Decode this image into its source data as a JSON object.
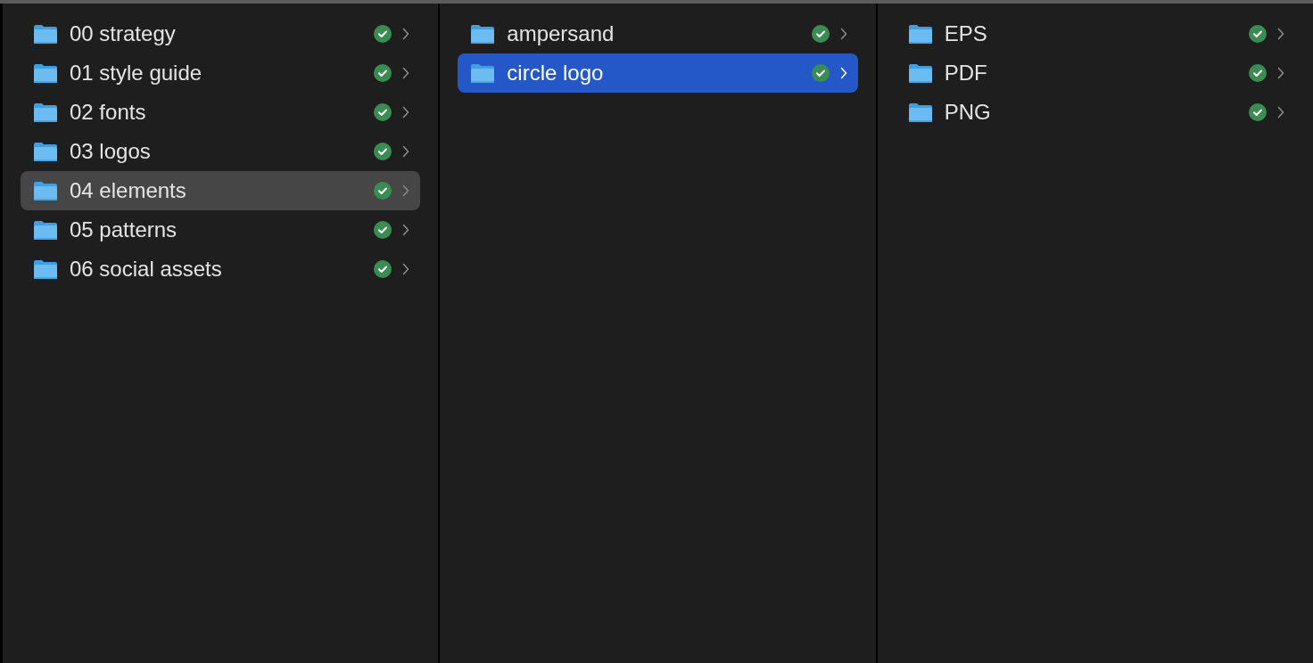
{
  "columns": [
    {
      "items": [
        {
          "name": "00 strategy",
          "synced": true,
          "selected": false,
          "focused": false
        },
        {
          "name": "01 style guide",
          "synced": true,
          "selected": false,
          "focused": false
        },
        {
          "name": "02 fonts",
          "synced": true,
          "selected": false,
          "focused": false
        },
        {
          "name": "03 logos",
          "synced": true,
          "selected": false,
          "focused": false
        },
        {
          "name": "04 elements",
          "synced": true,
          "selected": true,
          "focused": false
        },
        {
          "name": "05 patterns",
          "synced": true,
          "selected": false,
          "focused": false
        },
        {
          "name": "06 social assets",
          "synced": true,
          "selected": false,
          "focused": false
        }
      ]
    },
    {
      "items": [
        {
          "name": "ampersand",
          "synced": true,
          "selected": false,
          "focused": false
        },
        {
          "name": "circle logo",
          "synced": true,
          "selected": true,
          "focused": true
        }
      ]
    },
    {
      "items": [
        {
          "name": "EPS",
          "synced": true,
          "selected": false,
          "focused": false
        },
        {
          "name": "PDF",
          "synced": true,
          "selected": false,
          "focused": false
        },
        {
          "name": "PNG",
          "synced": true,
          "selected": false,
          "focused": false
        }
      ]
    }
  ]
}
